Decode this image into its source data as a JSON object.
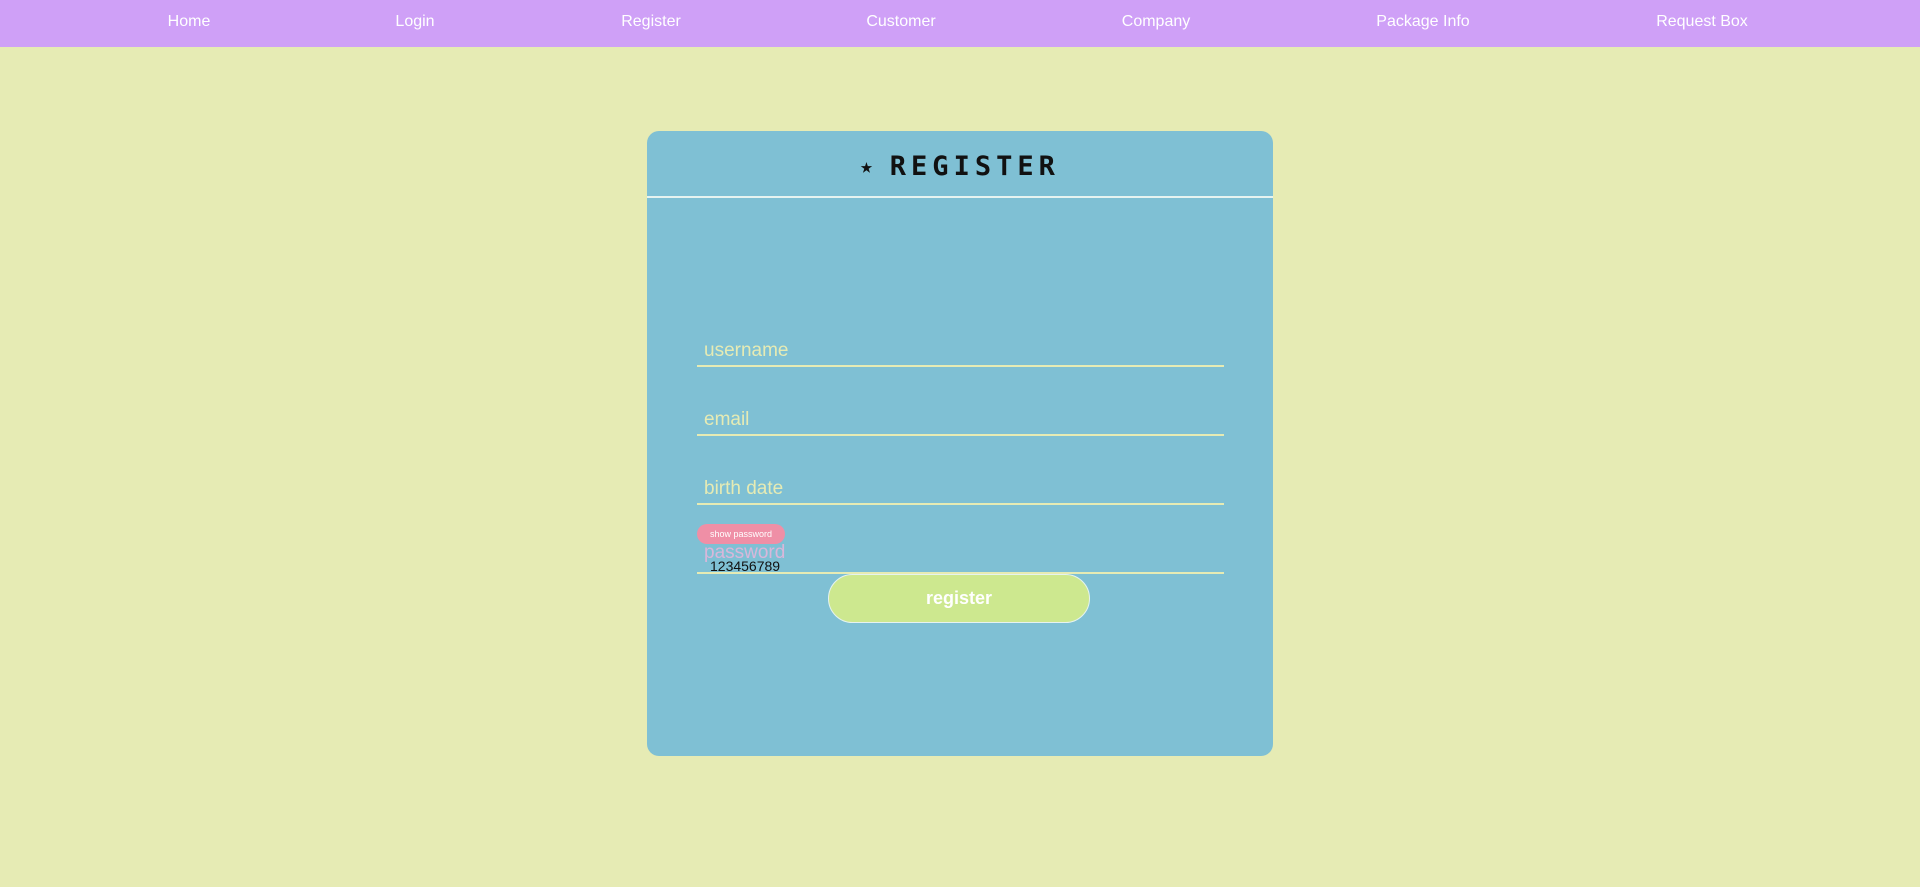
{
  "nav": {
    "items": [
      {
        "label": "Home"
      },
      {
        "label": "Login"
      },
      {
        "label": "Register"
      },
      {
        "label": "Customer"
      },
      {
        "label": "Company"
      },
      {
        "label": "Package Info"
      },
      {
        "label": "Request Box"
      }
    ]
  },
  "form": {
    "title": "REGISTER",
    "star_icon": "★",
    "fields": {
      "username": {
        "label": "username",
        "value": ""
      },
      "email": {
        "label": "email",
        "value": ""
      },
      "birth_date": {
        "label": "birth date",
        "value": ""
      },
      "password": {
        "label": "password",
        "value": "123456789"
      }
    },
    "show_password_label": "show password",
    "submit_label": "register"
  },
  "colors": {
    "background": "#e6ebb4",
    "navbar": "#cfa0f7",
    "card": "#7fc0d4",
    "show_password_button": "#ef8fa6",
    "register_button": "#cde88f"
  }
}
